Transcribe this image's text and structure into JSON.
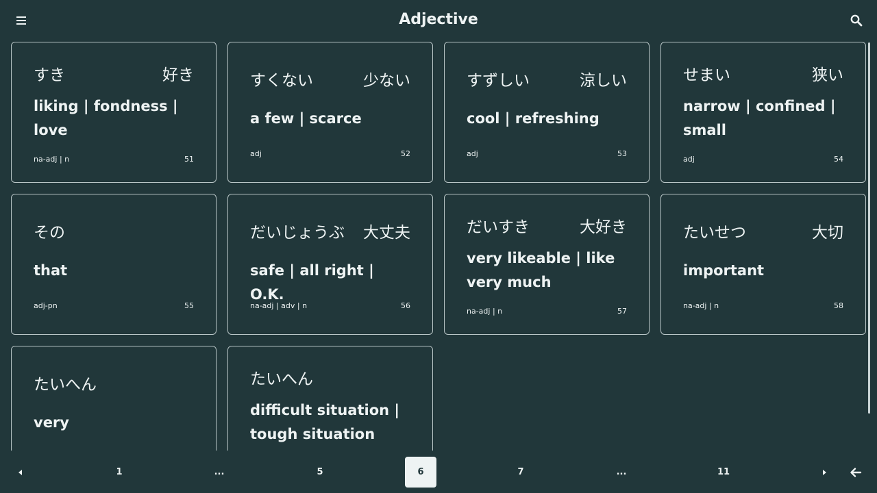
{
  "header": {
    "title": "Adjective",
    "menu_icon": "hamburger-menu-icon",
    "search_icon": "search-icon"
  },
  "cards": [
    {
      "kana": "すき",
      "kanji": "好き",
      "meaning": "liking | fondness | love",
      "pos": "na-adj | n",
      "num": "51"
    },
    {
      "kana": "すくない",
      "kanji": "少ない",
      "meaning": "a few | scarce",
      "pos": "adj",
      "num": "52"
    },
    {
      "kana": "すずしい",
      "kanji": "涼しい",
      "meaning": "cool | refreshing",
      "pos": "adj",
      "num": "53"
    },
    {
      "kana": "せまい",
      "kanji": "狭い",
      "meaning": "narrow | confined | small",
      "pos": "adj",
      "num": "54"
    },
    {
      "kana": "その",
      "kanji": "",
      "meaning": "that",
      "pos": "adj-pn",
      "num": "55"
    },
    {
      "kana": "だいじょうぶ",
      "kanji": "大丈夫",
      "meaning": "safe | all right | O.K.",
      "pos": "na-adj | adv | n",
      "num": "56"
    },
    {
      "kana": "だいすき",
      "kanji": "大好き",
      "meaning": "very likeable | like very much",
      "pos": "na-adj | n",
      "num": "57"
    },
    {
      "kana": "たいせつ",
      "kanji": "大切",
      "meaning": "important",
      "pos": "na-adj | n",
      "num": "58"
    },
    {
      "kana": "たいへん",
      "kanji": "",
      "meaning": "very",
      "pos": "",
      "num": ""
    },
    {
      "kana": "たいへん",
      "kanji": "",
      "meaning": "difficult situation | tough situation",
      "pos": "",
      "num": ""
    }
  ],
  "pagination": {
    "prev_icon": "triangle-left-icon",
    "next_icon": "triangle-right-icon",
    "back_icon": "arrow-left-icon",
    "pages": [
      "1",
      "...",
      "5",
      "6",
      "7",
      "...",
      "11"
    ],
    "current": "6"
  },
  "colors": {
    "background": "#21373a",
    "text": "#eef3f3",
    "card_border": "#b9c6c7",
    "active_page_bg": "#eef3f3"
  }
}
